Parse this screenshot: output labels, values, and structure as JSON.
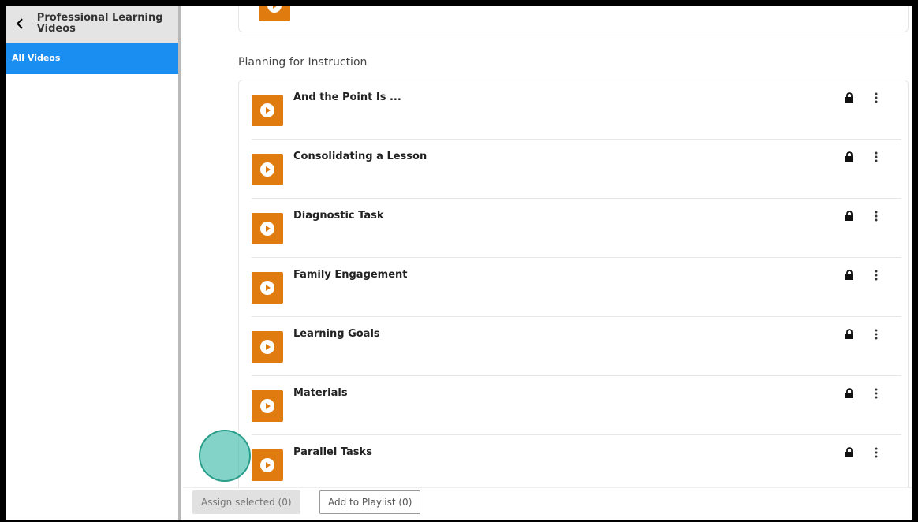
{
  "sidebar": {
    "title": "Professional Learning Videos",
    "items": [
      {
        "label": "All Videos",
        "active": true
      }
    ]
  },
  "main": {
    "section_title": "Planning for Instruction",
    "videos": [
      {
        "title": "And the Point Is ...",
        "locked": true
      },
      {
        "title": "Consolidating a Lesson",
        "locked": true
      },
      {
        "title": "Diagnostic Task",
        "locked": true
      },
      {
        "title": "Family Engagement",
        "locked": true
      },
      {
        "title": "Learning Goals",
        "locked": true
      },
      {
        "title": "Materials",
        "locked": true
      },
      {
        "title": "Parallel Tasks",
        "locked": true
      }
    ]
  },
  "bottom_bar": {
    "assign_label": "Assign selected (0)",
    "playlist_label": "Add to Playlist (0)"
  },
  "colors": {
    "accent": "#1b8ef2",
    "play_tile": "#e07b10",
    "cursor_highlight": "#40bcaa"
  },
  "icons": {
    "back": "chevron-left-icon",
    "play": "play-circle-icon",
    "lock": "lock-icon",
    "more": "kebab-menu-icon"
  }
}
